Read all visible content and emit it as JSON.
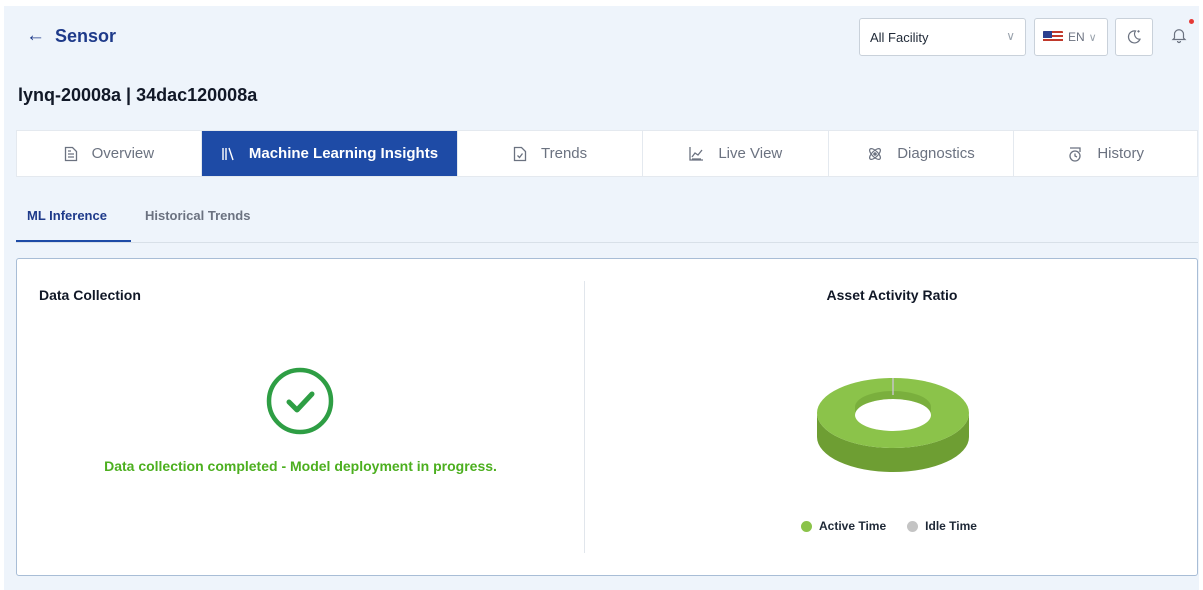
{
  "header": {
    "back_label": "Sensor",
    "facility_select": "All Facility",
    "language_select": "EN"
  },
  "device": {
    "title": "lynq-20008a | 34dac120008a"
  },
  "main_tabs": [
    {
      "label": "Overview",
      "icon": "document-icon",
      "active": false
    },
    {
      "label": "Machine Learning Insights",
      "icon": "library-icon",
      "active": true
    },
    {
      "label": "Trends",
      "icon": "file-check-icon",
      "active": false
    },
    {
      "label": "Live View",
      "icon": "chart-icon",
      "active": false
    },
    {
      "label": "Diagnostics",
      "icon": "atom-icon",
      "active": false
    },
    {
      "label": "History",
      "icon": "history-icon",
      "active": false
    }
  ],
  "sub_tabs": [
    {
      "label": "ML Inference",
      "active": true
    },
    {
      "label": "Historical Trends",
      "active": false
    }
  ],
  "data_collection": {
    "title": "Data Collection",
    "status": "Data collection completed - Model deployment in progress."
  },
  "asset_activity": {
    "title": "Asset Activity Ratio",
    "legend": [
      {
        "label": "Active Time",
        "color": "#8bc34a"
      },
      {
        "label": "Idle Time",
        "color": "#c4c4c4"
      }
    ]
  },
  "colors": {
    "accent": "#1e4ba6",
    "success": "#4caf1f",
    "active_time": "#8bc34a",
    "idle_time": "#c4c4c4"
  }
}
